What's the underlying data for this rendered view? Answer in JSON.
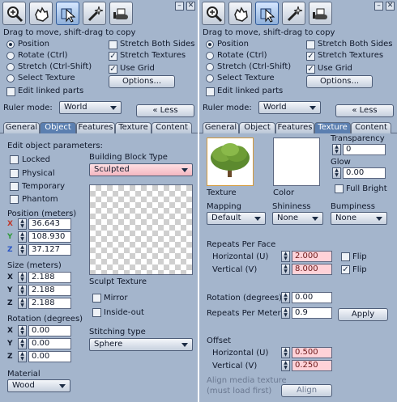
{
  "toolbar": {
    "icons": [
      "zoom-icon",
      "grab-hand-icon",
      "pointer-select-icon",
      "magic-wand-icon",
      "bulldozer-icon"
    ],
    "minimize": "–",
    "close": "✕"
  },
  "drag_hint": "Drag to move, shift-drag to copy",
  "options": {
    "position": "Position",
    "rotate": "Rotate (Ctrl)",
    "stretch": "Stretch (Ctrl-Shift)",
    "select_texture": "Select Texture",
    "stretch_both": "Stretch Both Sides",
    "stretch_textures": "Stretch Textures",
    "use_grid": "Use Grid",
    "options_btn": "Options...",
    "edit_linked": "Edit linked parts",
    "ruler_label": "Ruler mode:",
    "ruler_value": "World",
    "less_btn": "« Less"
  },
  "tabs": [
    "General",
    "Object",
    "Features",
    "Texture",
    "Content"
  ],
  "left": {
    "heading": "Edit object parameters:",
    "flags": [
      "Locked",
      "Physical",
      "Temporary",
      "Phantom"
    ],
    "position_label": "Position (meters)",
    "position": [
      "36.643",
      "108.930",
      "37.127"
    ],
    "size_label": "Size (meters)",
    "size": [
      "2.188",
      "2.188",
      "2.188"
    ],
    "rotation_label": "Rotation (degrees)",
    "rotation": [
      "0.00",
      "0.00",
      "0.00"
    ],
    "axes": [
      "X",
      "Y",
      "Z"
    ],
    "material_label": "Material",
    "material": "Wood",
    "bbt_label": "Building Block Type",
    "bbt": "Sculpted",
    "sculpt_label": "Sculpt Texture",
    "mirror": "Mirror",
    "inside_out": "Inside-out",
    "stitching_label": "Stitching type",
    "stitching": "Sphere"
  },
  "right": {
    "texture_label": "Texture",
    "color_label": "Color",
    "transparency_label": "Transparency",
    "transparency": "0",
    "glow_label": "Glow",
    "glow": "0.00",
    "full_bright": "Full Bright",
    "mapping_label": "Mapping",
    "mapping": "Default",
    "shininess_label": "Shininess",
    "shininess": "None",
    "bumpiness_label": "Bumpiness",
    "bumpiness": "None",
    "repeats_label": "Repeats Per Face",
    "horizontal_label": "Horizontal (U)",
    "horizontal": "2.000",
    "vertical_label": "Vertical (V)",
    "vertical": "8.000",
    "flip": "Flip",
    "rotation_label": "Rotation (degrees)",
    "rotation": "0.00",
    "rpm_label": "Repeats Per Meter",
    "rpm": "0.9",
    "apply": "Apply",
    "offset_label": "Offset",
    "offset_h": "0.500",
    "offset_v": "0.250",
    "align_label_1": "Align media texture",
    "align_label_2": "(must load first)",
    "align_btn": "Align"
  },
  "colors": {
    "panel": "#a4b5cc",
    "active_tab": "#5b7fb0",
    "highlight": "#ffd2d8",
    "axis_x": "#c0392b",
    "axis_y": "#2e9a3a",
    "axis_z": "#2a56c6"
  }
}
